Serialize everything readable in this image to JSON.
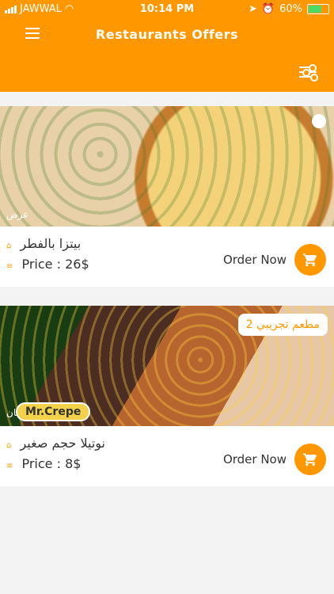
{
  "status_bar": {
    "carrier": "JAWWAL",
    "time": "10:14 PM",
    "battery": "60%"
  },
  "header": {
    "title": "Restaurants Offers"
  },
  "icons": {
    "menu": "hamburger-menu-icon",
    "filter": "sliders-icon",
    "cart": "shopping-cart-icon",
    "wifi": "wifi-icon",
    "location": "location-arrow-icon",
    "alarm": "alarm-clock-icon",
    "battery": "battery-icon"
  },
  "colors": {
    "accent": "#ff9800",
    "battery_fill": "#4cd964"
  },
  "offers": [
    {
      "name": "بيتزا بالفطر",
      "price": "Price : 26$",
      "order_label": "Order Now",
      "image_overlay_text": "عرض"
    },
    {
      "name": "نوتيلا حجم صغير",
      "price": "Price : 8$",
      "order_label": "Order Now",
      "restaurant_badge": "مطعم تجريبي 2",
      "image_overlay_text": "نان",
      "logo_text": "Mr.Crepe"
    }
  ]
}
